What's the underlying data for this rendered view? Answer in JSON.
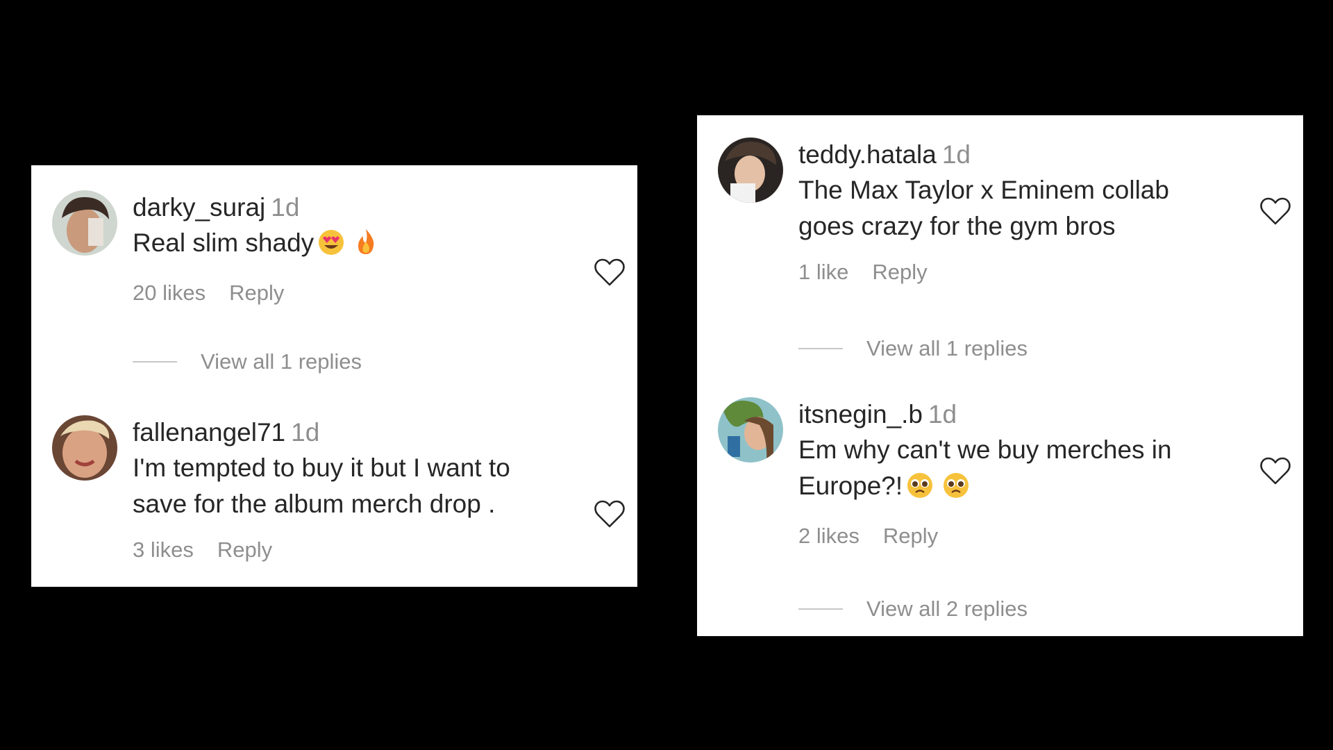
{
  "panels": [
    {
      "comments": [
        {
          "username": "darky_suraj",
          "time": "1d",
          "text": "Real slim shady",
          "emojis": [
            "heart-eyes-emoji",
            "fire-emoji"
          ],
          "likes": "20 likes",
          "reply_label": "Reply",
          "view_replies": "View all 1 replies"
        },
        {
          "username": "fallenangel71",
          "time": "1d",
          "text": "I'm tempted to buy it but I want to\nsave for the album merch drop .",
          "emojis": [],
          "likes": "3 likes",
          "reply_label": "Reply",
          "view_replies": ""
        }
      ]
    },
    {
      "comments": [
        {
          "username": "teddy.hatala",
          "time": "1d",
          "text": "The Max Taylor x Eminem collab\ngoes crazy for the gym bros",
          "emojis": [],
          "likes": "1 like",
          "reply_label": "Reply",
          "view_replies": "View all 1 replies"
        },
        {
          "username": "itsnegin_.b",
          "time": "1d",
          "text": "Em why can't we buy merches in\nEurope?!",
          "emojis": [
            "pleading-face-emoji",
            "pleading-face-emoji"
          ],
          "likes": "2 likes",
          "reply_label": "Reply",
          "view_replies": "View all 2 replies"
        }
      ]
    }
  ],
  "icons": {
    "like": "heart-outline-icon"
  },
  "colors": {
    "background": "#000000",
    "panel": "#ffffff",
    "primary_text": "#262626",
    "secondary_text": "#8e8e8e"
  }
}
